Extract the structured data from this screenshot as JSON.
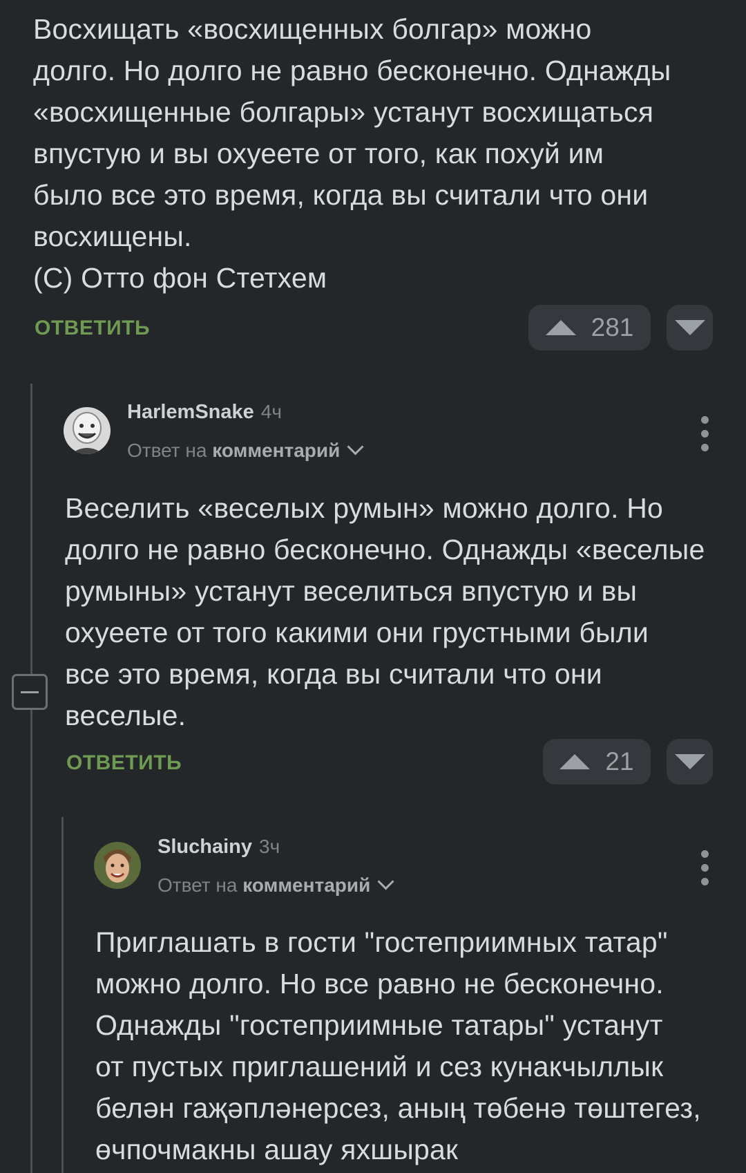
{
  "comment1": {
    "lines": [
      "Восхищать «восхищенных болгар» можно",
      "долго. Но долго не равно бесконечно. Однажды",
      "«восхищенные болгары» устанут восхищаться",
      "впустую и вы охуеете от того, как похуй им",
      "было все это время, когда вы считали что они",
      "восхищены.",
      "(С) Отто фон Стетхем"
    ],
    "reply_label": "ОТВЕТИТЬ",
    "rating": "281"
  },
  "comment2": {
    "username": "HarlemSnake",
    "time": "4ч",
    "reply_prefix": "Ответ на",
    "reply_target": "комментарий",
    "lines": [
      "Веселить «веселых румын» можно долго. Но",
      "долго не равно бесконечно. Однажды «веселые",
      "румыны» устанут веселиться впустую и вы",
      "охуеете от того какими они грустными были",
      "все это время, когда вы считали что они",
      "веселые."
    ],
    "reply_label": "ОТВЕТИТЬ",
    "rating": "21"
  },
  "comment3": {
    "username": "Sluchainy",
    "time": "3ч",
    "reply_prefix": "Ответ на",
    "reply_target": "комментарий",
    "lines": [
      "Приглашать в гости \"гостеприимных татар\"",
      "можно долго. Но все равно не бесконечно.",
      "Однажды \"гостеприимные татары\" устанут",
      "от пустых приглашений и сез кунакчыллык",
      "белән гаҗәпләнерсез, аның төбенә төштегез,",
      "өчпочмакны ашау яхшырак"
    ]
  },
  "colors": {
    "background": "#24272a",
    "accent_green": "#6e9a52",
    "pill": "#35393d"
  }
}
